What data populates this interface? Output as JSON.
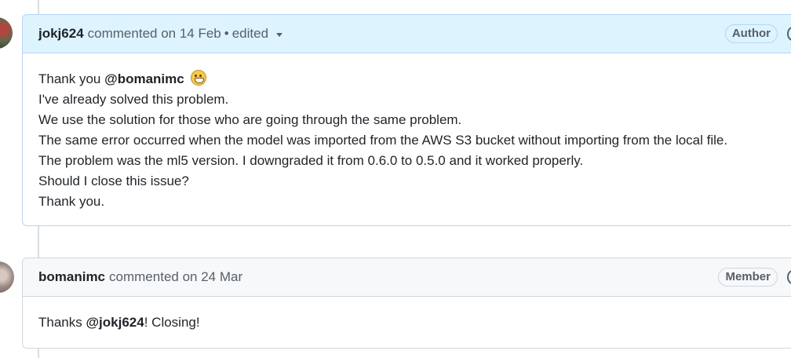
{
  "comments": [
    {
      "author": "jokj624",
      "action": "commented on 14 Feb",
      "separator": "•",
      "edited": "edited",
      "role": "Author",
      "body": {
        "line1_prefix": "Thank you",
        "mention": "@bomanimc",
        "lines": [
          "I've already solved this problem.",
          "We use the solution for those who are going through the same problem.",
          "The same error occurred when the model was imported from the AWS S3 bucket without importing from the local file.",
          "The problem was the ml5 version. I downgraded it from 0.6.0 to 0.5.0 and it worked properly.",
          "Should I close this issue?",
          "Thank you."
        ]
      }
    },
    {
      "author": "bomanimc",
      "action": "commented on 24 Mar",
      "role": "Member",
      "body": {
        "prefix": "Thanks",
        "mention": "@jokj624",
        "suffix": "! Closing!"
      }
    }
  ]
}
